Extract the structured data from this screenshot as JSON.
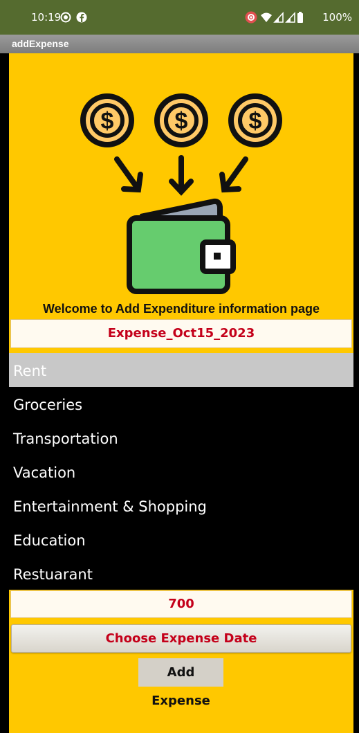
{
  "status_bar": {
    "time": "10:19",
    "battery": "100%",
    "icons": [
      "screen-record-icon",
      "facebook-icon",
      "cast-icon",
      "wifi-icon",
      "signal-icon",
      "signal-icon",
      "battery-icon"
    ]
  },
  "title_bar": {
    "title": "addExpense"
  },
  "header": {
    "image": "wallet-with-coins-illustration",
    "welcome": "Welcome to Add Expenditure information page"
  },
  "expense_name": {
    "value": "Expense_Oct15_2023"
  },
  "categories": {
    "selected": "Rent",
    "items": [
      "Rent",
      "Groceries",
      "Transportation",
      "Vacation",
      "Entertainment & Shopping",
      "Education",
      "Restuarant"
    ]
  },
  "amount": {
    "value": "700"
  },
  "buttons": {
    "choose_date": "Choose Expense Date",
    "add_expense": "Add Expense"
  },
  "colors": {
    "status_bar": "#556b2f",
    "background": "#ffc800",
    "accent_text": "#c4001a",
    "wallet": "#66cc6e",
    "coin": "#ffc967"
  }
}
